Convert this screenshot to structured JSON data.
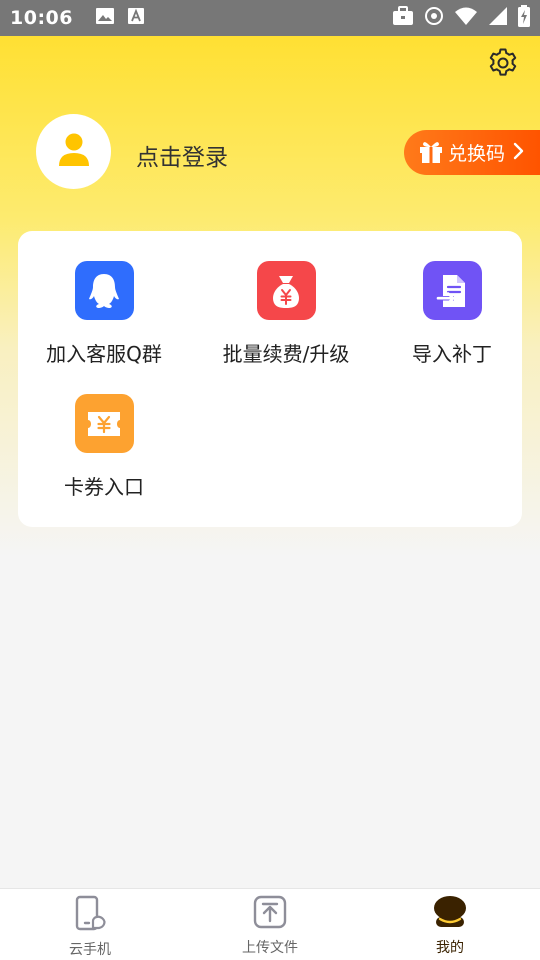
{
  "status_bar": {
    "time": "10:06"
  },
  "profile": {
    "login_label": "点击登录"
  },
  "redeem": {
    "label": "兑换码"
  },
  "menu": {
    "items": [
      {
        "label": "加入客服Q群",
        "icon": "qq-penguin-icon",
        "color": "#2f6dfd"
      },
      {
        "label": "批量续费/升级",
        "icon": "money-bag-icon",
        "color": "#f5474a"
      },
      {
        "label": "导入补丁",
        "icon": "file-import-icon",
        "color": "#7053f5"
      },
      {
        "label": "卡券入口",
        "icon": "coupon-icon",
        "color": "#fda230"
      }
    ]
  },
  "bottom_nav": {
    "items": [
      {
        "label": "云手机",
        "icon": "phone-icon",
        "active": false
      },
      {
        "label": "上传文件",
        "icon": "upload-icon",
        "active": false
      },
      {
        "label": "我的",
        "icon": "user-icon",
        "active": true
      }
    ]
  },
  "colors": {
    "accent_yellow": "#ffe033",
    "redeem_orange": "#ff5400",
    "active_nav": "#3a2200"
  }
}
